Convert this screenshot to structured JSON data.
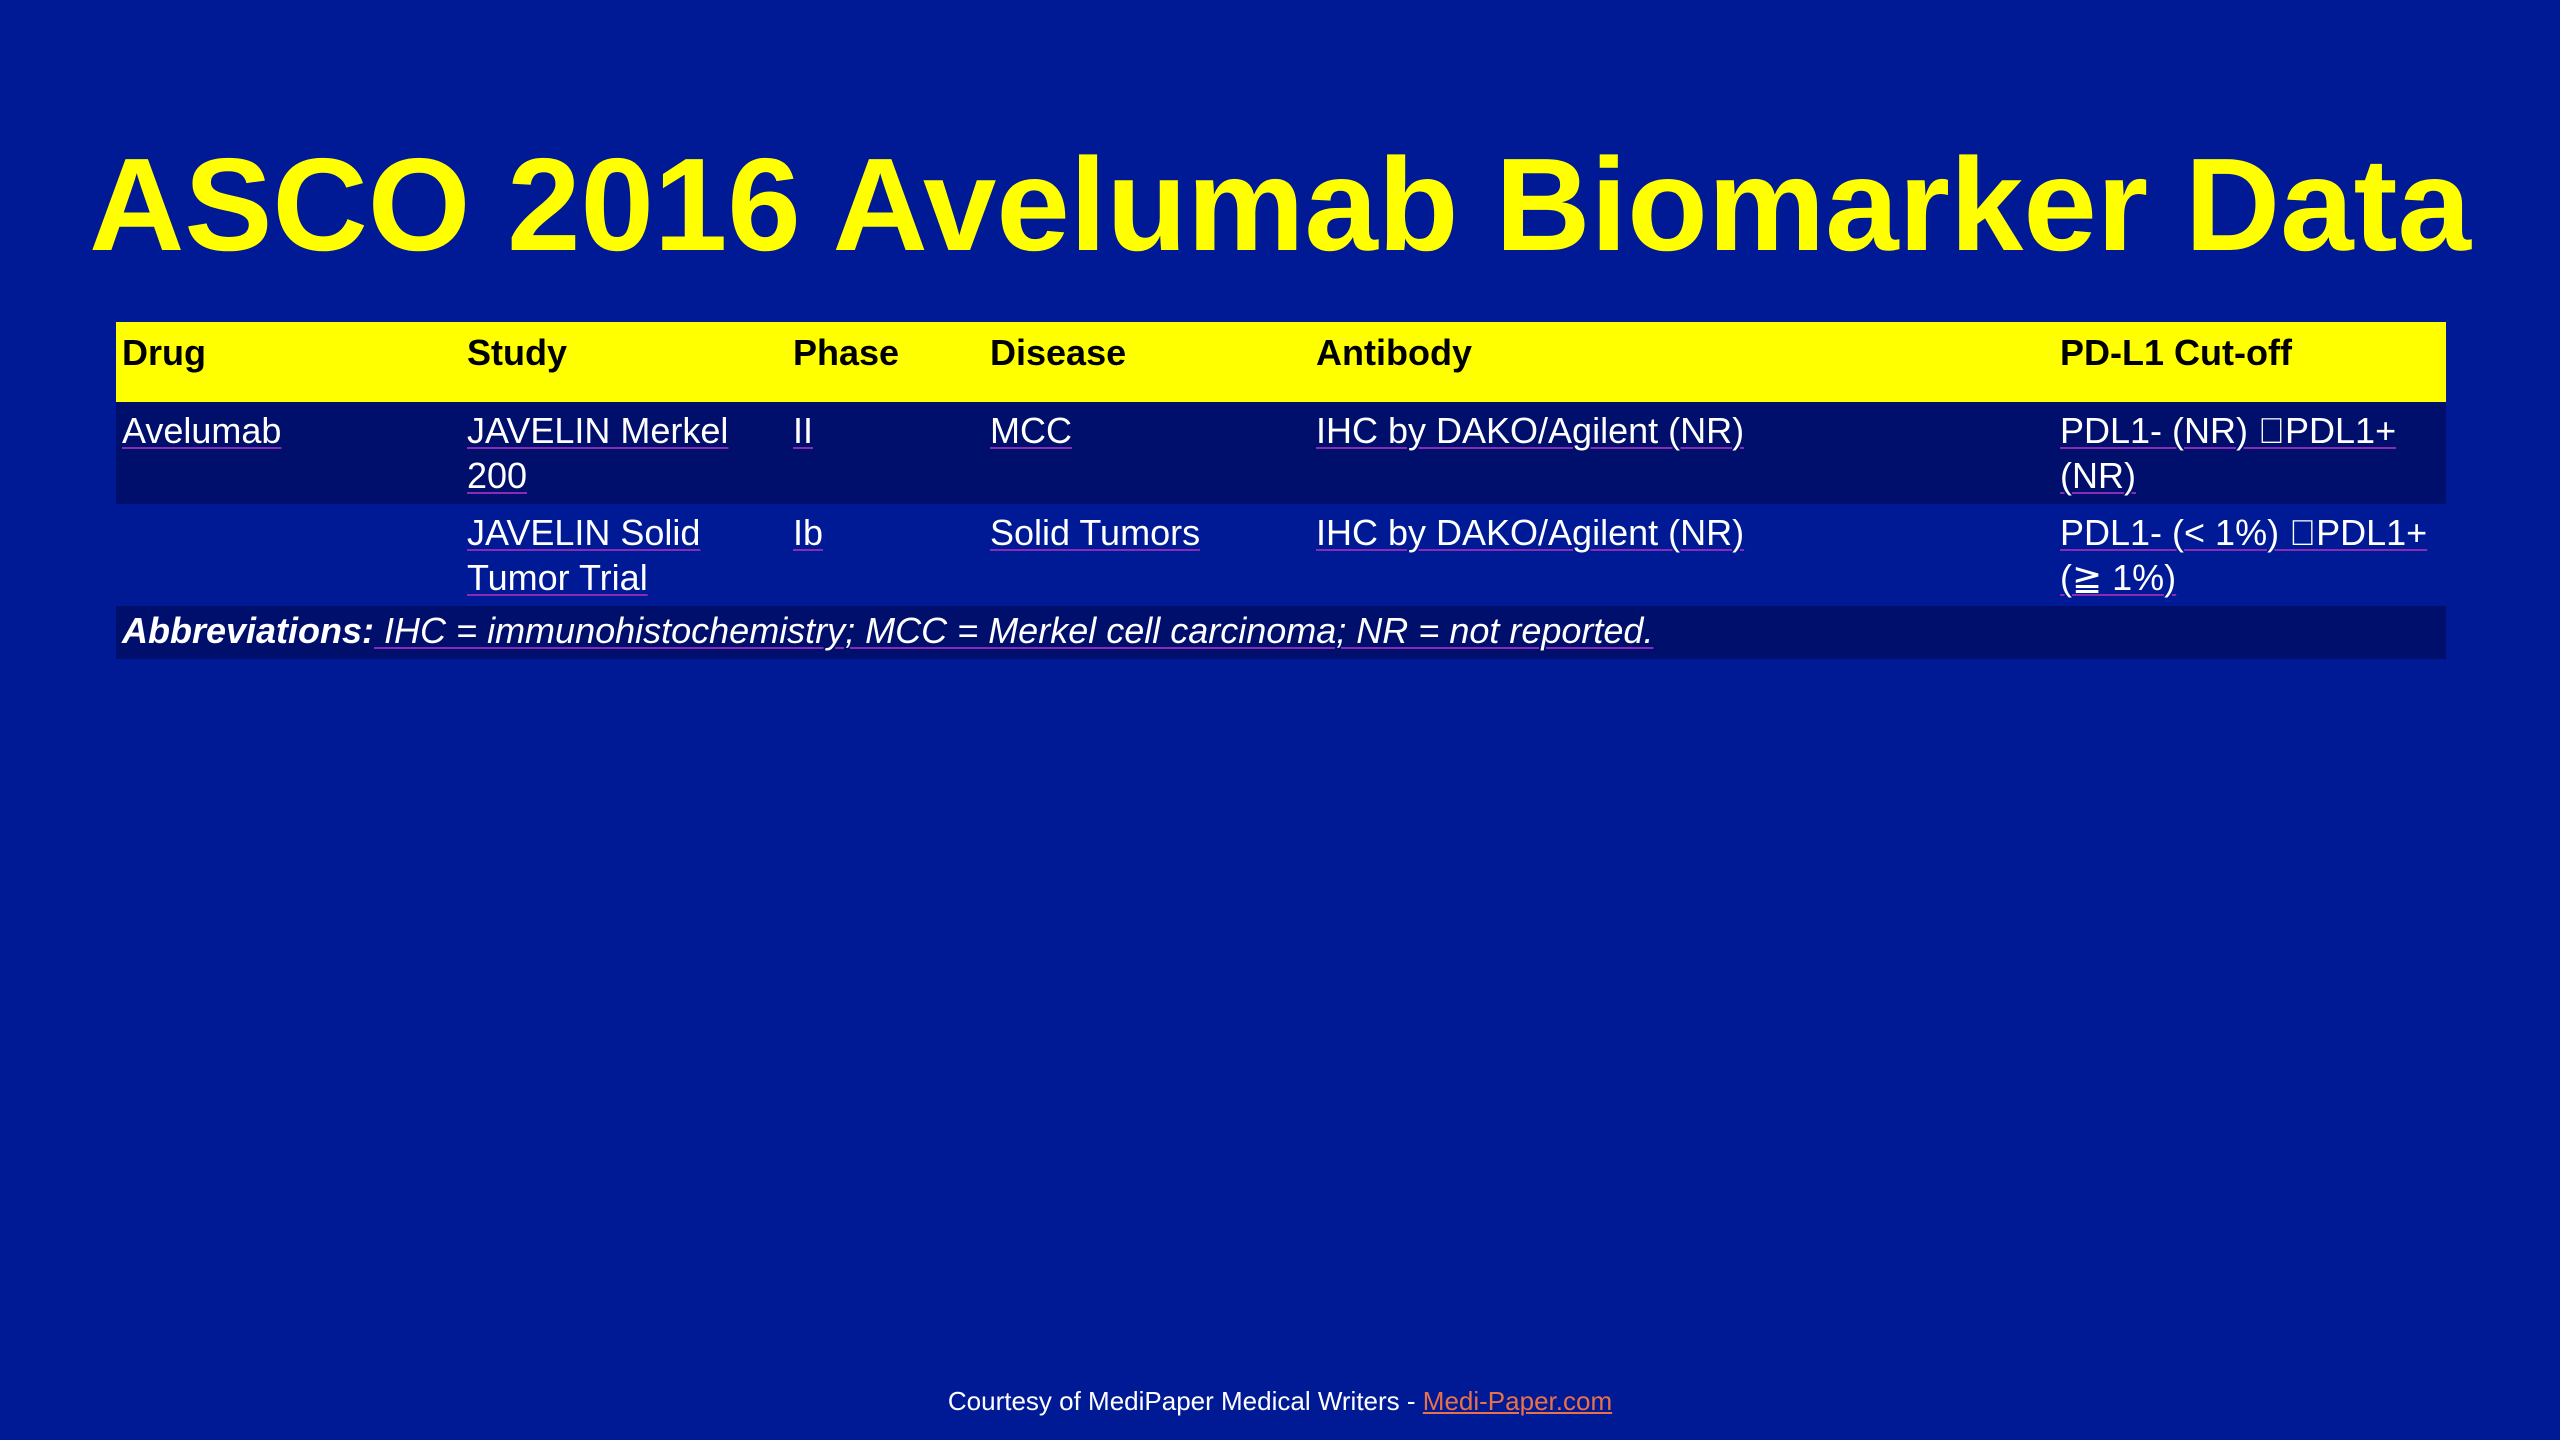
{
  "slide": {
    "title": "ASCO 2016 Avelumab Biomarker Data"
  },
  "table": {
    "headers": [
      "Drug",
      "Study",
      "Phase",
      "Disease",
      "Antibody",
      "PD-L1 Cut-off"
    ],
    "rows": [
      [
        "Avelumab",
        "JAVELIN Merkel 200",
        "II",
        "MCC",
        "IHC by DAKO/Agilent (NR)",
        "PDL1- (NR) PDL1+ (NR)"
      ],
      [
        "",
        "JAVELIN Solid Tumor Trial",
        "Ib",
        "Solid Tumors",
        "IHC by DAKO/Agilent (NR)",
        "PDL1- (< 1%) PDL1+ (≧ 1%)"
      ]
    ],
    "abbreviations_label": "Abbreviations:",
    "abbreviations_text": " IHC = immunohistochemistry; MCC = Merkel cell carcinoma; NR = not reported."
  },
  "footer": {
    "text": "Courtesy of MediPaper Medical Writers  -  ",
    "link_text": "Medi-Paper.com"
  },
  "colors": {
    "background": "#001a96",
    "title": "#ffff00",
    "header_fill": "#ffff00",
    "row_dark": "#000f6b",
    "link": "#e8714a"
  }
}
